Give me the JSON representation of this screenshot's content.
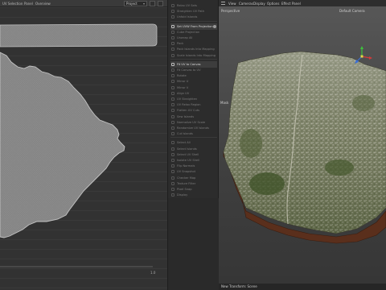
{
  "uv_editor": {
    "menu": [
      "UV Selection",
      "Panel",
      "Overview"
    ],
    "projection_select": "Project",
    "axis_end_label": "1.0"
  },
  "tool_panel": {
    "rows": [
      {
        "label": "Relax UV Sets",
        "highlight": false
      },
      {
        "label": "Straighten UV Path",
        "highlight": false
      },
      {
        "label": "Unfold Islands",
        "highlight": false
      },
      {
        "label": "Set UVW From Projection",
        "highlight": true,
        "action_dot": true
      },
      {
        "label": "Cube Projection",
        "highlight": false
      },
      {
        "label": "Unwrap All",
        "highlight": false
      },
      {
        "label": "Pack",
        "highlight": false
      },
      {
        "label": "Pack Islands Into Mapping",
        "highlight": false
      },
      {
        "label": "Scale Islands Into Mapping",
        "highlight": false
      },
      {
        "label": "Fit UV to Canvas",
        "highlight": true,
        "action_dot": false
      },
      {
        "label": "Fit Canvas to UV",
        "highlight": false
      },
      {
        "label": "Rotate",
        "highlight": false
      },
      {
        "label": "Mirror U",
        "highlight": false
      },
      {
        "label": "Mirror V",
        "highlight": false
      },
      {
        "label": "Align UV",
        "highlight": false
      },
      {
        "label": "UV Straighten",
        "highlight": false
      },
      {
        "label": "UV Relax Region",
        "highlight": false
      },
      {
        "label": "Flatten UV Cuts",
        "highlight": false
      },
      {
        "label": "Sew Islands",
        "highlight": false
      },
      {
        "label": "Normalize UV Scale",
        "highlight": false
      },
      {
        "label": "Randomize UV Islands",
        "highlight": false
      },
      {
        "label": "Cut Islands",
        "highlight": false
      },
      {
        "label": "Select All",
        "highlight": false
      },
      {
        "label": "Select Islands",
        "highlight": false
      },
      {
        "label": "Select UV Shell",
        "highlight": false
      },
      {
        "label": "Isolate UV Shell",
        "highlight": false
      },
      {
        "label": "Flip Normals",
        "highlight": false
      },
      {
        "label": "UV Snapshot",
        "highlight": false
      },
      {
        "label": "Checker Map",
        "highlight": false
      },
      {
        "label": "Texture Filter",
        "highlight": false
      },
      {
        "label": "Pixel Snap",
        "highlight": false
      },
      {
        "label": "Display",
        "highlight": false
      }
    ]
  },
  "viewport": {
    "menu": [
      "View",
      "Cameras",
      "Display",
      "Options",
      "Effect",
      "Panel"
    ],
    "projection_label": "Perspective",
    "camera_label": "Default Camera",
    "side_label": "Mask",
    "status": "New Transform: Scene",
    "colors": {
      "terrain": "#6a7150",
      "terrain_light": "#a9ab97",
      "soil": "#5a2f1c",
      "soil_dark": "#3b1d10"
    }
  }
}
